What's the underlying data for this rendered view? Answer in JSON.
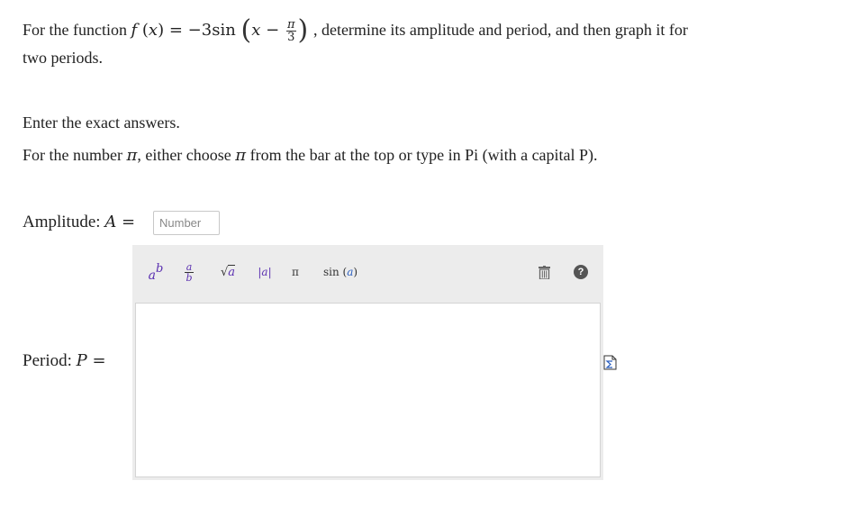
{
  "question": {
    "prefix": "For the function ",
    "func_name": "f",
    "func_var": "x",
    "rhs_coef": "−3",
    "rhs_fn": "sin",
    "rhs_var": "x",
    "frac_num": "π",
    "frac_den": "3",
    "suffix": ", determine its amplitude and period, and then graph it for",
    "line2": "two periods."
  },
  "instructions": {
    "line1": "Enter the exact answers.",
    "line2_a": "For the number ",
    "line2_pi": "π",
    "line2_b": ", either choose ",
    "line2_pi2": "π",
    "line2_c": " from the bar at the top or type in Pi (with a capital P)."
  },
  "amplitude": {
    "label": "Amplitude: ",
    "var": "A",
    "eq": " =",
    "input_placeholder": "Number",
    "input_value": ""
  },
  "period": {
    "label": "Period: ",
    "var": "P",
    "eq": " ="
  },
  "toolbar": {
    "power_base": "a",
    "power_exp": "b",
    "frac_num": "a",
    "frac_den": "b",
    "sqrt_symbol": "√",
    "sqrt_arg": "a",
    "abs_arg": "|a|",
    "pi": "π",
    "sin_fn": "sin",
    "sin_arg": "a",
    "help_label": "?"
  },
  "colors": {
    "accent_purple": "#5a2fb0",
    "accent_blue": "#2b5fbf",
    "toolbar_bg": "#ececec"
  }
}
